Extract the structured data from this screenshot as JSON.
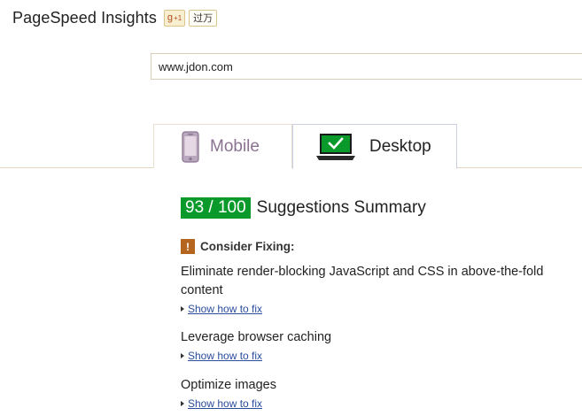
{
  "header": {
    "title": "PageSpeed Insights",
    "gplus_label": "g",
    "gplus_sup": "+1",
    "plus_count": "过万"
  },
  "search": {
    "value": "www.jdon.com"
  },
  "tabs": [
    {
      "label": "Mobile",
      "icon": "mobile-phone-icon",
      "active": false
    },
    {
      "label": "Desktop",
      "icon": "desktop-laptop-icon",
      "active": true
    }
  ],
  "summary": {
    "score": "93 / 100",
    "title": "Suggestions Summary"
  },
  "consider": {
    "label": "Consider Fixing:",
    "icon": "warning-icon",
    "color": "#b5651d"
  },
  "items": [
    {
      "title": "Eliminate render-blocking JavaScript and CSS in above-the-fold content",
      "link": "Show how to fix"
    },
    {
      "title": "Leverage browser caching",
      "link": "Show how to fix"
    },
    {
      "title": "Optimize images",
      "link": "Show how to fix"
    }
  ],
  "colors": {
    "score_green": "#0a9a2b",
    "link_blue": "#2a4d9c"
  }
}
